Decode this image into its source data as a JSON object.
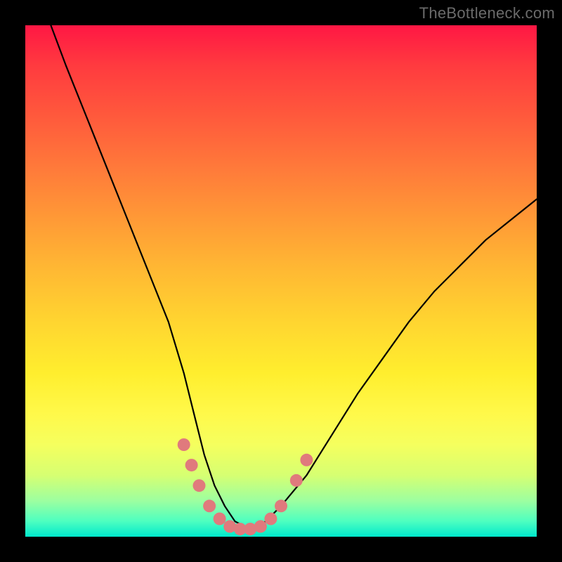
{
  "watermark": "TheBottleneck.com",
  "colors": {
    "frame": "#000000",
    "gradient_top": "#ff1744",
    "gradient_mid": "#ffd530",
    "gradient_bottom": "#00e8cc",
    "curve": "#000000",
    "marker": "#e07a7d"
  },
  "chart_data": {
    "type": "line",
    "title": "",
    "xlabel": "",
    "ylabel": "",
    "xlim": [
      0,
      100
    ],
    "ylim": [
      0,
      100
    ],
    "series": [
      {
        "name": "bottleneck-curve",
        "x": [
          5,
          8,
          12,
          16,
          20,
          24,
          28,
          31,
          33,
          35,
          37,
          39,
          41,
          43,
          45,
          47,
          50,
          55,
          60,
          65,
          70,
          75,
          80,
          85,
          90,
          95,
          100
        ],
        "y": [
          100,
          92,
          82,
          72,
          62,
          52,
          42,
          32,
          24,
          16,
          10,
          6,
          3,
          2,
          2,
          3,
          6,
          12,
          20,
          28,
          35,
          42,
          48,
          53,
          58,
          62,
          66
        ]
      }
    ],
    "markers": [
      {
        "x": 31,
        "y": 18
      },
      {
        "x": 32.5,
        "y": 14
      },
      {
        "x": 34,
        "y": 10
      },
      {
        "x": 36,
        "y": 6
      },
      {
        "x": 38,
        "y": 3.5
      },
      {
        "x": 40,
        "y": 2
      },
      {
        "x": 42,
        "y": 1.5
      },
      {
        "x": 44,
        "y": 1.5
      },
      {
        "x": 46,
        "y": 2
      },
      {
        "x": 48,
        "y": 3.5
      },
      {
        "x": 50,
        "y": 6
      },
      {
        "x": 53,
        "y": 11
      },
      {
        "x": 55,
        "y": 15
      }
    ]
  }
}
